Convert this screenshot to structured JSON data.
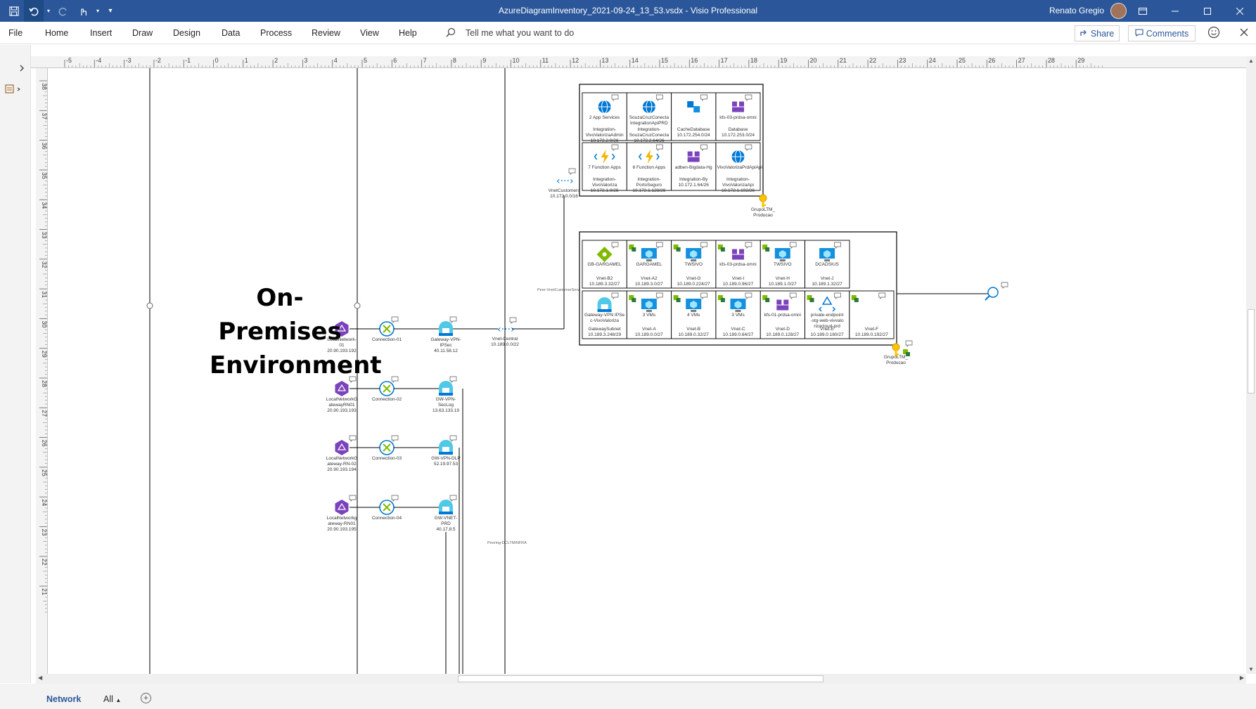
{
  "titlebar": {
    "document_title": "AzureDiagramInventory_2021-09-24_13_53.vsdx  -  Visio Professional",
    "user_name": "Renato Gregio"
  },
  "ribbon": {
    "menu": [
      "File",
      "Home",
      "Insert",
      "Draw",
      "Design",
      "Data",
      "Process",
      "Review",
      "View",
      "Help"
    ],
    "tell_me": "Tell me what you want to do",
    "share": "Share",
    "comments": "Comments"
  },
  "ruler": {
    "top_ticks": [
      "-5",
      "-4",
      "-3",
      "-2",
      "-1",
      "0",
      "1",
      "2",
      "3",
      "4",
      "5",
      "6",
      "7",
      "8",
      "9",
      "10",
      "11",
      "12",
      "13",
      "14",
      "15",
      "16",
      "17",
      "18",
      "19",
      "20",
      "21",
      "22",
      "23",
      "24",
      "25",
      "26",
      "27",
      "28",
      "29"
    ],
    "left_ticks": [
      "38",
      "37",
      "36",
      "35",
      "34",
      "33",
      "32",
      "31",
      "30",
      "29",
      "28",
      "27",
      "26",
      "25",
      "24",
      "23",
      "22",
      "21"
    ]
  },
  "diagram": {
    "heading_line1": "On-Premises",
    "heading_line2": "Environment",
    "local_networks": [
      {
        "name": "LocalNetwork-01",
        "ip": "20.90.193.192"
      },
      {
        "name": "LocalNetworkGatewayRN01",
        "ip": "20.90.193.193"
      },
      {
        "name": "LocalNetworkGateway-RN-02",
        "ip": "20.90.193.194"
      },
      {
        "name": "LocalNetworkGateway-RN01",
        "ip": "20.90.193.195"
      }
    ],
    "connections": [
      "Connection-01",
      "Connection-02",
      "Connection-03",
      "Connection-04"
    ],
    "gateways": [
      {
        "name": "Gateway-VPN-IPSec",
        "ip": "40.11.58.12"
      },
      {
        "name": "GW-VPN-SecLog",
        "ip": "13.63.133.19"
      },
      {
        "name": "GW-VPN-DLP",
        "ip": "52.19.97.53"
      },
      {
        "name": "GW-VNET-PRD",
        "ip": "40.17.8.5"
      }
    ],
    "vnet_central": {
      "name": "Vnet-Central",
      "ip": "10.189.0.0/22"
    },
    "vnet_customers": {
      "name": "VnetCustomers",
      "ip": "10.172.0.0/16"
    },
    "peer_label_1": "Peer-VnetCustomerServ",
    "peer_label_2": "Peering-DCLTMINFRA",
    "top_group": {
      "rows": [
        [
          {
            "title": "2 App Services",
            "name": "Integration-VivoValorizaAdmin",
            "ip": "10.172.2.0/26"
          },
          {
            "title": "SouzaCruzConecta IntegrationApiPRD",
            "name": "Integration-SouzaCruzConecta",
            "ip": "10.172.2.64/26"
          },
          {
            "title": "",
            "name": "CacheDatabase",
            "ip": "10.172.254.0/24"
          },
          {
            "title": "kfs-03-prdsa-omni",
            "name": "Database",
            "ip": "10.172.253.0/24"
          }
        ],
        [
          {
            "title": "7 Function Apps",
            "name": "Integration-VivoValoriza",
            "ip": "10.172.1.0/26"
          },
          {
            "title": "6 Function Apps",
            "name": "Integration-PortoSeguro",
            "ip": "10.172.1.128/26"
          },
          {
            "title": "adben-Bigdata-Hg",
            "name": "Integration-By",
            "ip": "10.172.1.64/26"
          },
          {
            "title": "VivoValorizaPrdApiApi",
            "name": "Integration-VivoValorizaApi",
            "ip": "10.172.1.192/26"
          }
        ]
      ],
      "key_label": "GrupoLTM_Producao"
    },
    "bottom_group": {
      "rows": [
        [
          {
            "title": "GB-GARGAMEL",
            "name": "Vnet-B2",
            "ip": "10.189.3.32/27"
          },
          {
            "title": "GARGAMEL",
            "name": "Vnet-A2",
            "ip": "10.189.3.0/27"
          },
          {
            "title": "TWSIVO",
            "name": "Vnet-G",
            "ip": "10.189.0.224/27"
          },
          {
            "title": "kfs-03-prdsa-omni",
            "name": "Vnet-I",
            "ip": "10.189.0.96/27"
          },
          {
            "title": "TWSIVO",
            "name": "Vnet-H",
            "ip": "10.189.1.0/27"
          },
          {
            "title": "DCADSIUS",
            "name": "Vnet-J",
            "ip": "10.189.1.32/27"
          }
        ],
        [
          {
            "title": "Gateway-VPN IPSec-VivoValoriza",
            "name": "GatewaySubnet",
            "ip": "10.189.3.248/29"
          },
          {
            "title": "3 VMs",
            "name": "Vnet-A",
            "ip": "10.189.0.0/27"
          },
          {
            "title": "4 VMs",
            "name": "Vnet-B",
            "ip": "10.189.0.32/27"
          },
          {
            "title": "3 VMs",
            "name": "Vnet-C",
            "ip": "10.189.0.64/27"
          },
          {
            "title": "kfs-01-prdsa-omni",
            "name": "Vnet-D",
            "ip": "10.189.0.128/27"
          },
          {
            "title": "private-endpoint-stg-web-vivvalorizacloud-prd",
            "name": "Vnet-E",
            "ip": "10.189.0.160/27"
          },
          {
            "title": "",
            "name": "Vnet-F",
            "ip": "10.189.0.192/27"
          }
        ]
      ],
      "key_label": "GrupoLTM_Producao"
    }
  },
  "status": {
    "tab_network": "Network",
    "tab_all": "All"
  },
  "colors": {
    "titlebar": "#2b579a",
    "accent": "#2b579a",
    "azure_blue": "#0078d4",
    "purple": "#7b42bc"
  }
}
